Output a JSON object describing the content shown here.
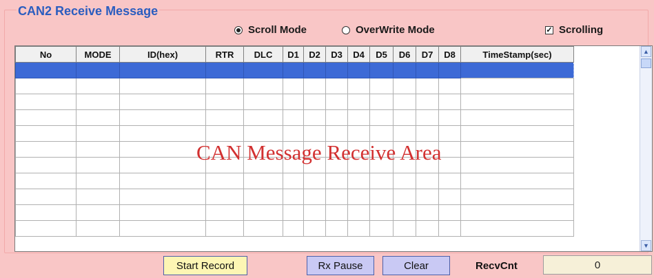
{
  "group_title": "CAN2 Receive Message",
  "mode": {
    "scroll_label": "Scroll Mode",
    "overwrite_label": "OverWrite Mode",
    "selected": "scroll"
  },
  "scrolling": {
    "label": "Scrolling",
    "checked": true
  },
  "table": {
    "columns": [
      "No",
      "MODE",
      "ID(hex)",
      "RTR",
      "DLC",
      "D1",
      "D2",
      "D3",
      "D4",
      "D5",
      "D6",
      "D7",
      "D8",
      "TimeStamp(sec)"
    ],
    "row_count": 11,
    "selected_row": 0
  },
  "overlay_text": "CAN Message Receive Area",
  "buttons": {
    "start_record": "Start Record",
    "rx_pause": "Rx Pause",
    "clear": "Clear"
  },
  "recv": {
    "label": "RecvCnt",
    "value": "0"
  }
}
